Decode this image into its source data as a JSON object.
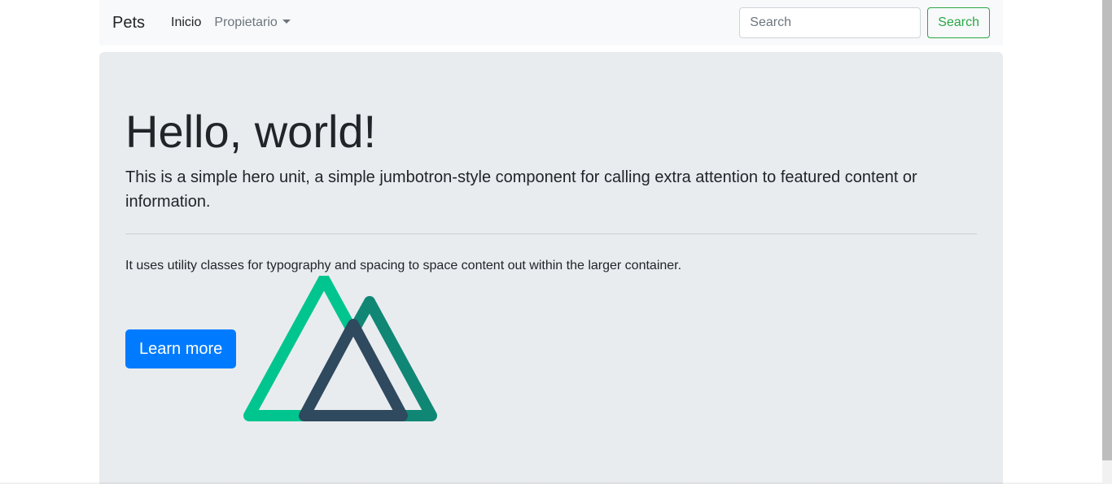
{
  "navbar": {
    "brand": "Pets",
    "links": [
      {
        "label": "Inicio",
        "active": true
      },
      {
        "label": "Propietario",
        "dropdown": true
      }
    ],
    "search": {
      "placeholder": "Search",
      "value": "",
      "button_label": "Search"
    }
  },
  "hero": {
    "title": "Hello, world!",
    "lead": "This is a simple hero unit, a simple jumbotron-style component for calling extra attention to featured content or information.",
    "body": "It uses utility classes for typography and spacing to space content out within the larger container.",
    "button_label": "Learn more",
    "logo_icon": "nuxt-logo-icon"
  },
  "colors": {
    "navbar_bg": "#f8f9fa",
    "jumbotron_bg": "#e9ecef",
    "primary": "#007bff",
    "success": "#28a745",
    "logo_green": "#00c58e",
    "logo_teal": "#108775",
    "logo_dark": "#2f495e"
  }
}
